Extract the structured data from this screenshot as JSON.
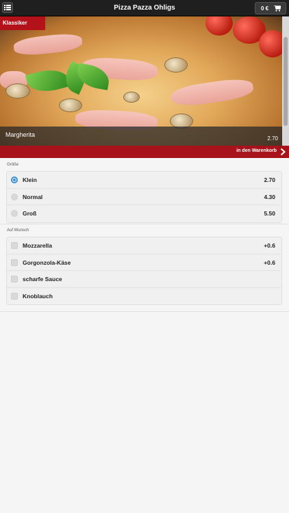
{
  "header": {
    "title": "Pizza Pazza Ohligs",
    "menu_icon": "list-icon",
    "cart_amount": "0 €",
    "cart_icon": "cart-icon"
  },
  "product": {
    "category": "Klassiker",
    "name": "Margherita",
    "price": "2.70",
    "add_to_cart_label": "in den Warenkorb"
  },
  "sizes": {
    "label": "Größe",
    "options": [
      {
        "label": "Klein",
        "price": "2.70",
        "selected": true
      },
      {
        "label": "Normal",
        "price": "4.30",
        "selected": false
      },
      {
        "label": "Groß",
        "price": "5.50",
        "selected": false
      }
    ]
  },
  "extras": {
    "label": "Auf Wunsch",
    "options": [
      {
        "label": "Mozzarella",
        "price": "+0.6",
        "checked": false
      },
      {
        "label": "Gorgonzola-Käse",
        "price": "+0.6",
        "checked": false
      },
      {
        "label": "scharfe Sauce",
        "price": "",
        "checked": false
      },
      {
        "label": "Knoblauch",
        "price": "",
        "checked": false
      }
    ]
  },
  "colors": {
    "header_bg": "#1f1f1f",
    "accent_red": "#b3121b",
    "radio_blue": "#3b8fd1"
  }
}
